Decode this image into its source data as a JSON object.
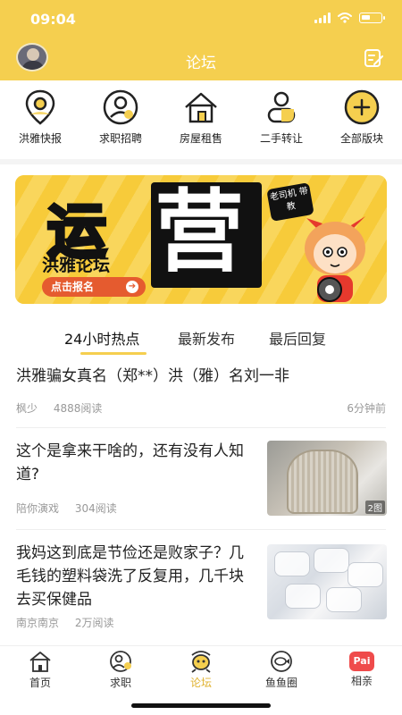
{
  "status": {
    "time": "09:04"
  },
  "header": {
    "title": "论坛"
  },
  "categories": [
    {
      "label": "洪雅快报",
      "icon": "location-pin-icon"
    },
    {
      "label": "求职招聘",
      "icon": "user-profile-icon"
    },
    {
      "label": "房屋租售",
      "icon": "house-icon"
    },
    {
      "label": "二手转让",
      "icon": "person-icon"
    },
    {
      "label": "全部版块",
      "icon": "plus-circle-icon"
    }
  ],
  "banner": {
    "big_char_1": "运",
    "big_char_2": "营",
    "subtitle": "洪雅论坛",
    "button": "点击报名",
    "tag": "老司机 带教"
  },
  "tabs": [
    {
      "label": "24小时热点",
      "active": true
    },
    {
      "label": "最新发布",
      "active": false
    },
    {
      "label": "最后回复",
      "active": false
    }
  ],
  "posts": [
    {
      "title": "洪雅骗女真名（郑**）洪（雅）名刘一非",
      "author": "枫少",
      "reads": "4888阅读",
      "time": "6分钟前"
    },
    {
      "title": "这个是拿来干啥的，还有没有人知道?",
      "author": "陪你演戏",
      "reads": "304阅读",
      "image_count": "2图"
    },
    {
      "title": "我妈这到底是节俭还是败家子？几毛钱的塑料袋洗了反复用，几千块去买保健品",
      "author": "南京南京",
      "reads": "2万阅读"
    }
  ],
  "bottom_nav": [
    {
      "label": "首页",
      "icon": "home-icon"
    },
    {
      "label": "求职",
      "icon": "job-icon"
    },
    {
      "label": "论坛",
      "icon": "forum-icon",
      "active": true
    },
    {
      "label": "鱼鱼圈",
      "icon": "fish-circle-icon"
    },
    {
      "label": "相亲",
      "icon": "pai-icon",
      "badge": "Pai"
    }
  ],
  "colors": {
    "accent": "#f5cf4f",
    "banner_button": "#e55b2f",
    "pai": "#ef4b4b"
  }
}
